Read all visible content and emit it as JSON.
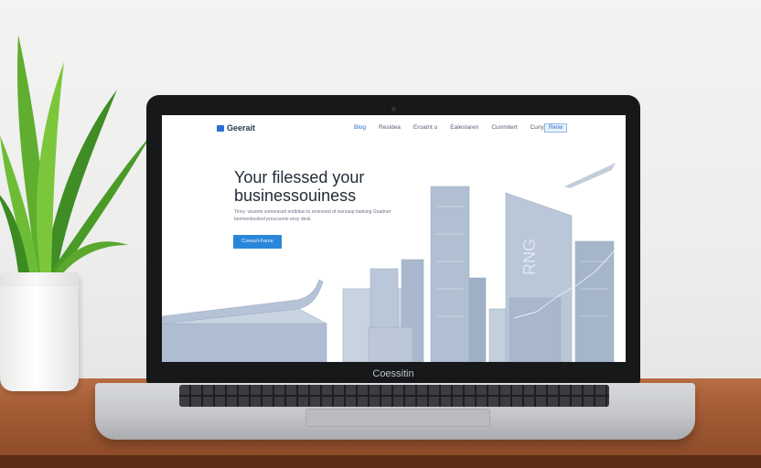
{
  "site": {
    "logo_text": "Geerait",
    "nav_links": [
      "Blog",
      "Residea",
      "Eroatnt u",
      "Ealestaren",
      "Cunmitert",
      "Cuny"
    ],
    "nav_button": "Renw",
    "hero_title": "Your filessed your businessouiness",
    "hero_subtitle": "Tinvy: visuinte somemssd endbltan to reneoned of ownrasp banking Gnadnet benhemitesknd prescseets envy desk.",
    "cta_label": "Coeaull-Fame"
  },
  "laptop": {
    "brand": "Coessitin"
  },
  "colors": {
    "accent": "#2b86d9",
    "title": "#1f2a36",
    "illustration": "#a9b8cc"
  },
  "icons": [
    "logo-icon",
    "plant-icon"
  ]
}
